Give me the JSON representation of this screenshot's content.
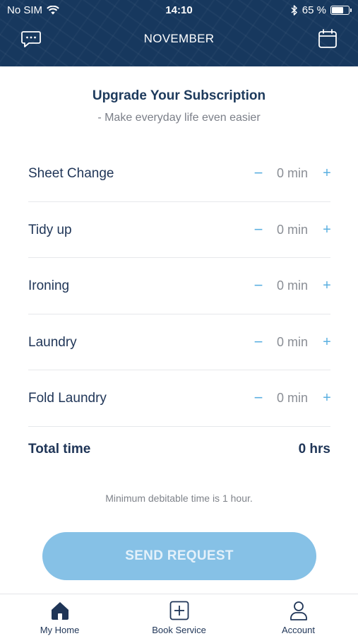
{
  "status_bar": {
    "carrier": "No SIM",
    "time": "14:10",
    "battery_percent": "65 %"
  },
  "header": {
    "title": "NOVEMBER",
    "left_icon": "chat-icon",
    "right_icon": "calendar-icon"
  },
  "upgrade": {
    "title": "Upgrade Your Subscription",
    "subtitle": "- Make everyday life even easier"
  },
  "services": [
    {
      "name": "Sheet Change",
      "value": "0 min",
      "minus": "−",
      "plus": "+"
    },
    {
      "name": "Tidy up",
      "value": "0 min",
      "minus": "−",
      "plus": "+"
    },
    {
      "name": "Ironing",
      "value": "0 min",
      "minus": "−",
      "plus": "+"
    },
    {
      "name": "Laundry",
      "value": "0 min",
      "minus": "−",
      "plus": "+"
    },
    {
      "name": "Fold Laundry",
      "value": "0 min",
      "minus": "−",
      "plus": "+"
    }
  ],
  "total": {
    "label": "Total time",
    "value": "0 hrs"
  },
  "note": "Minimum debitable time is 1 hour.",
  "send_button": "SEND REQUEST",
  "tabs": [
    {
      "label": "My Home",
      "icon": "home-icon"
    },
    {
      "label": "Book Service",
      "icon": "plus-square-icon"
    },
    {
      "label": "Account",
      "icon": "person-icon"
    }
  ],
  "colors": {
    "header_bg": "#17385e",
    "accent": "#5aafe0",
    "button_bg": "#86c1e6",
    "text_dark": "#1f3557"
  }
}
